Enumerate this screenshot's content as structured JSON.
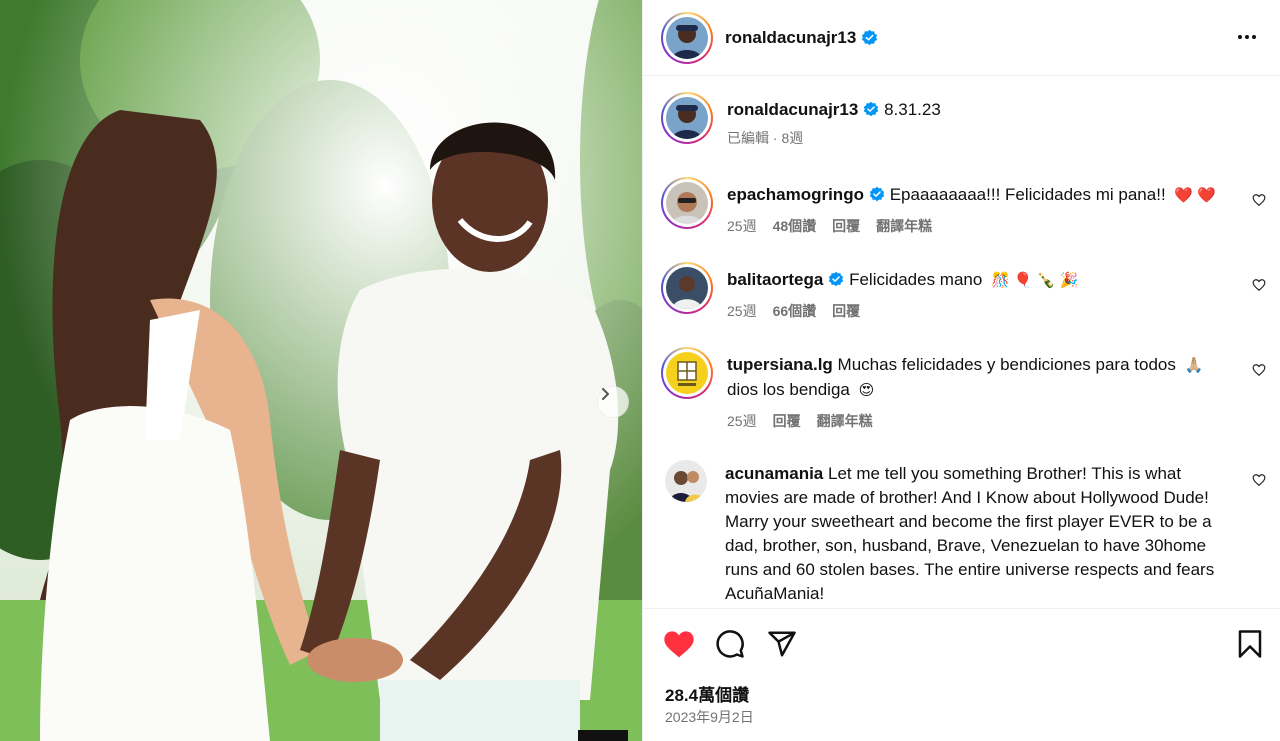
{
  "post": {
    "username": "ronaldacunajr13",
    "caption": "8.31.23",
    "caption_meta": "已編輯 · 8週",
    "likes": "28.4萬個讚",
    "date": "2023年9月2日"
  },
  "comments": [
    {
      "username": "epachamogringo",
      "verified": true,
      "text": "Epaaaaaaaa!!! Felicidades mi pana!!",
      "emoji": "❤️ ❤️",
      "time": "25週",
      "likes": "48個讚",
      "reply": "回覆",
      "translate": "翻譯年糕"
    },
    {
      "username": "balitaortega",
      "verified": true,
      "text": "Felicidades mano",
      "emoji": "🎊 🎈 🍾 🎉",
      "time": "25週",
      "likes": "66個讚",
      "reply": "回覆"
    },
    {
      "username": "tupersiana.lg",
      "verified": false,
      "text": "Muchas felicidades y bendiciones para todos",
      "emoji": "🙏🏼",
      "text2": "dios los bendiga",
      "emoji2": "😍",
      "time": "25週",
      "reply": "回覆",
      "translate": "翻譯年糕"
    },
    {
      "username": "acunamania",
      "verified": false,
      "text": "Let me tell you something Brother! This is what movies are made of brother! And I Know about Hollywood Dude! Marry your sweetheart and become the first player EVER to be a dad, brother, son, husband, Brave, Venezuelan to have 30home runs and 60 stolen bases. The entire universe respects and fears AcuñaMania!"
    }
  ],
  "icons": {
    "verified": "verified-badge-icon",
    "more": "more-options-icon",
    "like": "heart-icon",
    "comment": "comment-icon",
    "share": "share-icon",
    "save": "bookmark-icon",
    "next": "chevron-right-icon"
  },
  "colors": {
    "like_red": "#ff3040",
    "verified_blue": "#0095f6",
    "meta_gray": "#737373"
  }
}
